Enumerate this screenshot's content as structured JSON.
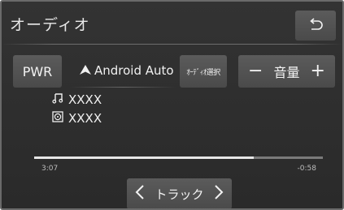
{
  "header": {
    "title": "オーディオ",
    "back_icon": "return-arrow-icon"
  },
  "controls": {
    "power_label": "PWR",
    "source_name": "Android Auto",
    "source_icon": "android-auto-icon",
    "source_select_label": "ｵｰﾃﾞｨｵ選択",
    "volume_label": "音量",
    "volume_minus": "−",
    "volume_plus": "+"
  },
  "now_playing": {
    "song_icon": "music-note-icon",
    "song": "XXXX",
    "album_icon": "album-icon",
    "album": "XXXX"
  },
  "progress": {
    "elapsed": "3:07",
    "remaining": "-0:58",
    "fraction": 0.76
  },
  "track": {
    "label": "トラック",
    "prev_icon": "chevron-left-icon",
    "next_icon": "chevron-right-icon"
  },
  "colors": {
    "background": "#2e2e2e",
    "button": "#525252",
    "text": "#f0f0f0",
    "progress_fill": "#e6e6e6",
    "progress_track": "#7a7a7a"
  }
}
